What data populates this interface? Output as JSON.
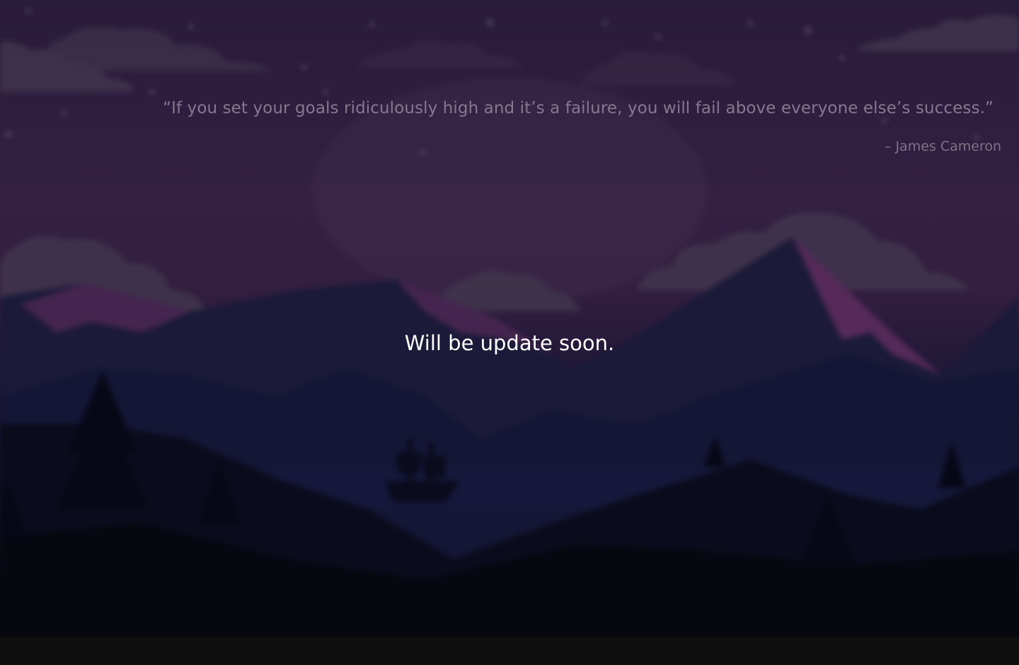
{
  "hero": {
    "quote_text": "“If you set your goals ridiculously high and it’s a failure, you will fail above everyone else’s success.”",
    "quote_author": "– James Cameron",
    "status_message": "Will be update soon."
  },
  "colors": {
    "sky_top": "#3b2650",
    "sky_mid": "#4a2d5e",
    "mountain_dark": "#1c1d45",
    "mountain_pink": "#8a3f86",
    "cloud": "#5e4d6e",
    "footer": "#0e0e0e",
    "message_text": "#ffffff",
    "quote_text": "#86798f"
  },
  "background": {
    "icon": "mountain-landscape-illustration"
  }
}
